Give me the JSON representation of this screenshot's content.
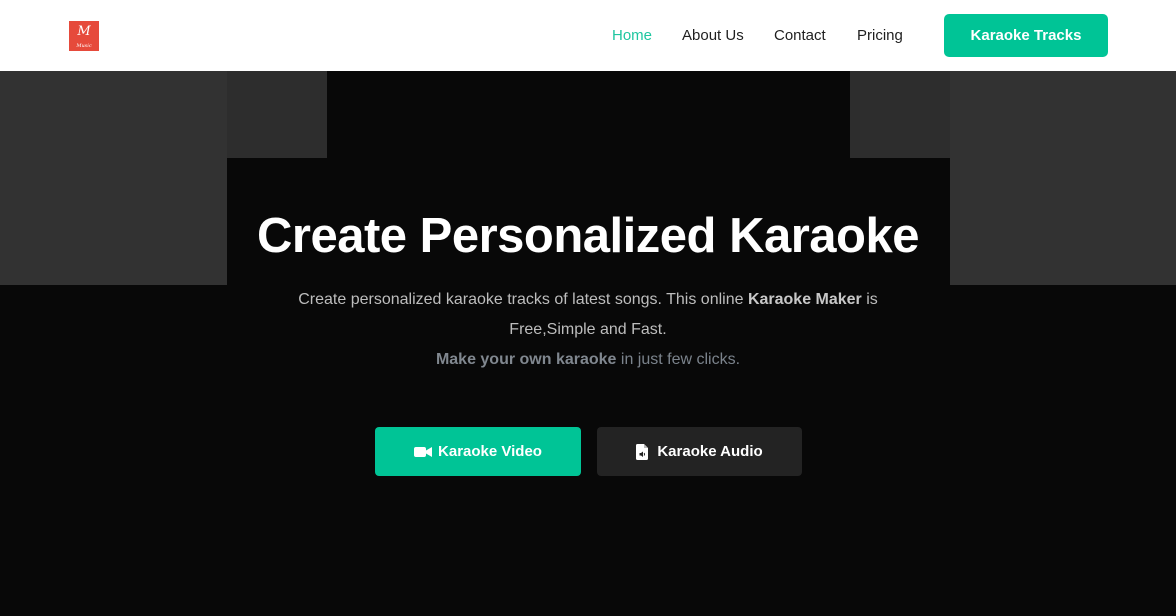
{
  "header": {
    "logo": {
      "letter": "M",
      "caption": "Music",
      "color": "#e64a3b"
    },
    "nav": [
      {
        "label": "Home",
        "active": true
      },
      {
        "label": "About Us",
        "active": false
      },
      {
        "label": "Contact",
        "active": false
      },
      {
        "label": "Pricing",
        "active": false
      }
    ],
    "cta_label": "Karaoke Tracks"
  },
  "hero": {
    "title": "Create Personalized Karaoke",
    "desc_prefix": "Create personalized karaoke tracks of latest songs. This online ",
    "desc_strong": "Karaoke Maker",
    "desc_suffix": " is Free,Simple and Fast.",
    "sub_strong": "Make your own karaoke",
    "sub_suffix": " in just few clicks.",
    "buttons": {
      "video": {
        "label": "Karaoke Video",
        "icon": "video-camera-icon"
      },
      "audio": {
        "label": "Karaoke Audio",
        "icon": "audio-file-icon"
      }
    }
  },
  "colors": {
    "accent": "#00c496",
    "nav_active": "#1fc6a0",
    "hero_bg": "#080808"
  }
}
